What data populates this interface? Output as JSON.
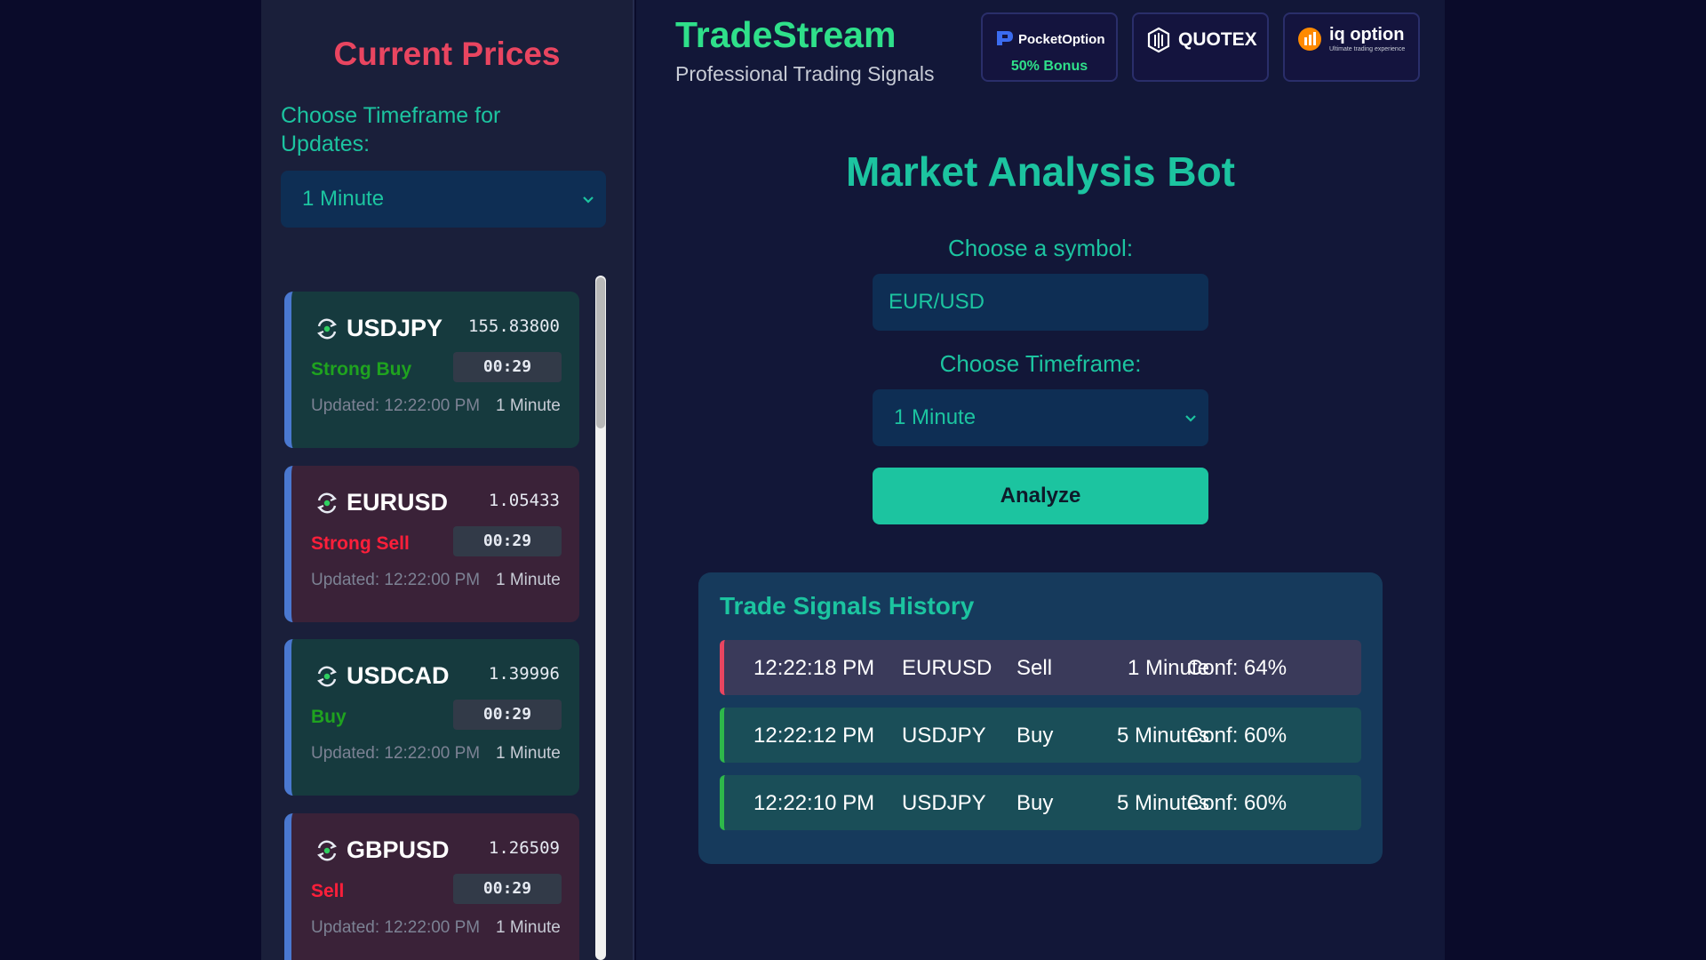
{
  "sidebar": {
    "title": "Current Prices",
    "timeframe_label": "Choose Timeframe for Updates:",
    "timeframe_value": "1 Minute",
    "cards": [
      {
        "symbol": "USDJPY",
        "price": "155.83800",
        "signal": "Strong Buy",
        "timer": "00:29",
        "updated": "Updated: 12:22:00 PM",
        "timeframe": "1 Minute"
      },
      {
        "symbol": "EURUSD",
        "price": "1.05433",
        "signal": "Strong Sell",
        "timer": "00:29",
        "updated": "Updated: 12:22:00 PM",
        "timeframe": "1 Minute"
      },
      {
        "symbol": "USDCAD",
        "price": "1.39996",
        "signal": "Buy",
        "timer": "00:29",
        "updated": "Updated: 12:22:00 PM",
        "timeframe": "1 Minute"
      },
      {
        "symbol": "GBPUSD",
        "price": "1.26509",
        "signal": "Sell",
        "timer": "00:29",
        "updated": "Updated: 12:22:00 PM",
        "timeframe": "1 Minute"
      }
    ]
  },
  "header": {
    "brand": "TradeStream",
    "tagline": "Professional Trading Signals",
    "brokers": [
      {
        "name": "PocketOption",
        "sub": "50% Bonus"
      },
      {
        "name": "QUOTEX"
      },
      {
        "name": "iq option",
        "sub": "Ultimate trading experience"
      }
    ]
  },
  "bot": {
    "title": "Market Analysis Bot",
    "symbol_label": "Choose a symbol:",
    "symbol_placeholder": "EUR/USD",
    "timeframe_label": "Choose Timeframe:",
    "timeframe_value": "1 Minute",
    "analyze_label": "Analyze"
  },
  "history": {
    "title": "Trade Signals History",
    "rows": [
      {
        "time": "12:22:18 PM",
        "symbol": "EURUSD",
        "direction": "Sell",
        "timeframe": "1 Minute",
        "confidence": "Conf: 64%"
      },
      {
        "time": "12:22:12 PM",
        "symbol": "USDJPY",
        "direction": "Buy",
        "timeframe": "5 Minutes",
        "confidence": "Conf: 60%"
      },
      {
        "time": "12:22:10 PM",
        "symbol": "USDJPY",
        "direction": "Buy",
        "timeframe": "5 Minutes",
        "confidence": "Conf: 60%"
      }
    ]
  },
  "colors": {
    "accent": "#1cc4a0",
    "brand": "#2fe08a",
    "sell": "#e94560",
    "buy": "#2eb84a"
  }
}
